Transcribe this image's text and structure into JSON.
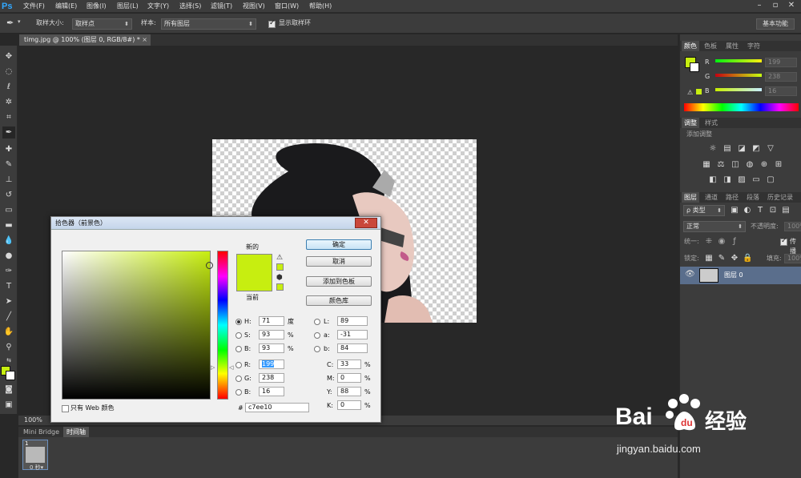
{
  "app": {
    "logo": "Ps"
  },
  "menu": [
    "文件(F)",
    "编辑(E)",
    "图像(I)",
    "图层(L)",
    "文字(Y)",
    "选择(S)",
    "滤镜(T)",
    "视图(V)",
    "窗口(W)",
    "帮助(H)"
  ],
  "window_controls": {
    "minimize": "–",
    "restore": "▫",
    "close": "✕"
  },
  "options": {
    "sample_size_label": "取样大小:",
    "sample_size_value": "取样点",
    "sample_label": "样本:",
    "sample_value": "所有图层",
    "show_ring_label": "显示取样环",
    "workspace": "基本功能"
  },
  "document": {
    "tab_title": "timg.jpg @ 100% (图层 0, RGB/8#) *",
    "close": "×",
    "zoom": "100%"
  },
  "bottom": {
    "tabs": [
      "Mini Bridge",
      "时间轴"
    ],
    "frame_number": "1",
    "frame_time": "0 秒▾"
  },
  "panels": {
    "color_tabs": [
      "颜色",
      "色板",
      "属性",
      "字符"
    ],
    "r_label": "R",
    "g_label": "G",
    "b_label": "B",
    "r_value": "199",
    "g_value": "238",
    "b_value": "16",
    "adjust_tabs": [
      "调整",
      "样式"
    ],
    "add_adjustment": "添加调整",
    "layers_tabs": [
      "图层",
      "通道",
      "路径",
      "段落",
      "历史记录"
    ],
    "kind": "ρ 类型",
    "blend": "正常",
    "opacity_label": "不透明度:",
    "opacity_value": "100%",
    "unify_label": "统一:",
    "propagate_label": "传播",
    "lock_label": "锁定:",
    "fill_label": "填充:",
    "fill_value": "100%",
    "layer_name": "图层 0"
  },
  "picker": {
    "title": "拾色器（前景色）",
    "close": "✕",
    "new_label": "新的",
    "current_label": "当前",
    "ok": "确定",
    "cancel": "取消",
    "add_swatch": "添加到色板",
    "libraries": "颜色库",
    "H_label": "H:",
    "H": "71",
    "H_unit": "度",
    "S_label": "S:",
    "S": "93",
    "S_unit": "%",
    "Bv_label": "B:",
    "Bv": "93",
    "Bv_unit": "%",
    "R_label": "R:",
    "R": "199",
    "G_label": "G:",
    "G": "238",
    "B_label": "B:",
    "B": "16",
    "L_label": "L:",
    "L": "89",
    "a_label": "a:",
    "a": "-31",
    "b_label": "b:",
    "b": "84",
    "C_label": "C:",
    "C": "33",
    "M_label": "M:",
    "M": "0",
    "Y_label": "Y:",
    "Y": "88",
    "K_label": "K:",
    "K": "0",
    "pct": "%",
    "hex_label": "#",
    "hex": "c7ee10",
    "web_only_label": "只有 Web 颜色"
  },
  "watermark": {
    "brand": "Bai",
    "brand2": "经验",
    "url": "jingyan.baidu.com"
  },
  "colors": {
    "foreground": "#c7ee10",
    "background": "#ffffff",
    "accent": "#31a8ff"
  },
  "icons": {
    "eyedropper": "eyedropper-icon",
    "eye": "eye-icon"
  }
}
